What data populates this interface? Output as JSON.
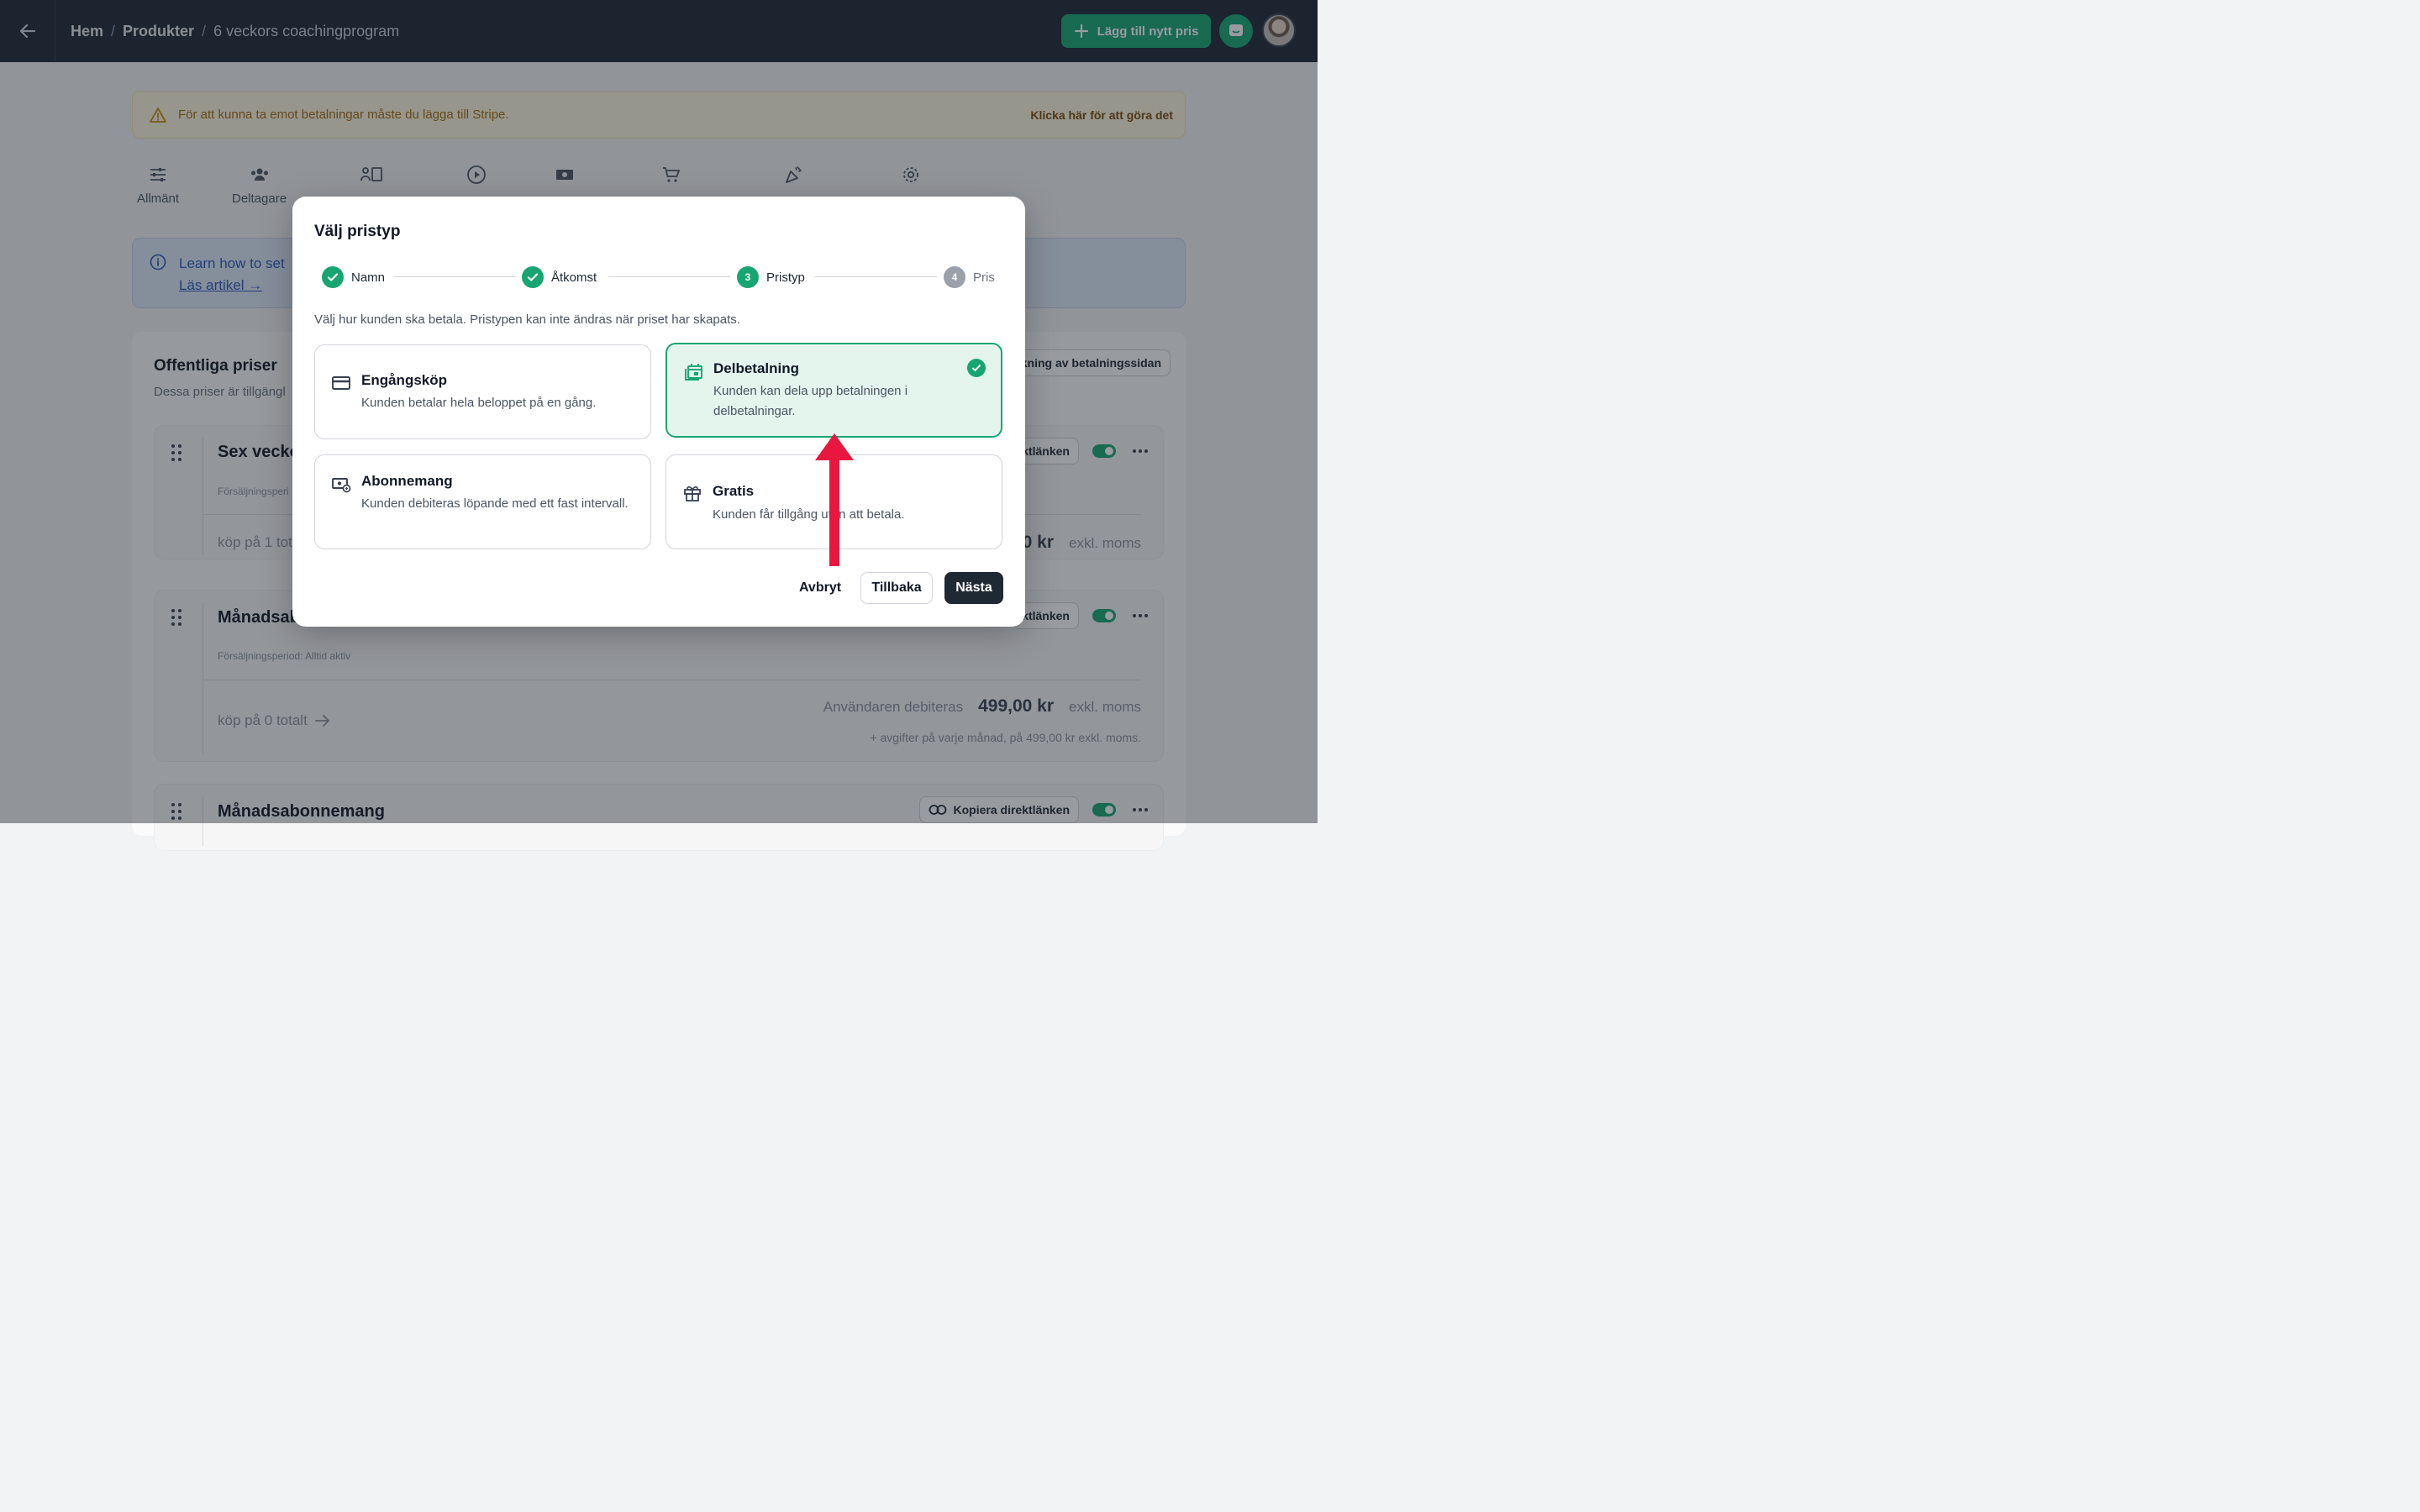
{
  "topbar": {
    "breadcrumb": [
      "Hem",
      "Produkter",
      "6 veckors coachingprogram"
    ],
    "add_price_label": "Lägg till nytt pris"
  },
  "warning": {
    "text": "För att kunna ta emot betalningar måste du lägga till Stripe.",
    "link": "Klicka här för att göra det"
  },
  "nav_tabs": [
    "Allmänt",
    "Deltagare"
  ],
  "info": {
    "text": "Learn how to set",
    "link": "Läs artikel →"
  },
  "prices_section": {
    "title": "Offentliga priser",
    "subtitle": "Dessa priser är tillgängl",
    "order_button": "kning av betalningssidan",
    "cards": [
      {
        "title": "Sex veckor",
        "period": "Försäljningsperi",
        "sold": "köp på 1 tot",
        "amount": "0 kr",
        "tax": "exkl. moms",
        "copy": "ktlänken"
      },
      {
        "title": "Månadsab",
        "period": "Försäljningsperiod: Alltid aktiv",
        "sold": "köp på 0 totalt",
        "debit_label": "Användaren debiteras",
        "amount": "499,00 kr",
        "tax": "exkl. moms",
        "fee": "+ avgifter på varje månad, på 499,00 kr exkl. moms.",
        "copy": "ktlänken"
      },
      {
        "title": "Månadsabonnemang",
        "copy": "Kopiera direktlänken"
      }
    ]
  },
  "modal": {
    "title": "Välj pristyp",
    "steps": [
      {
        "label": "Namn",
        "state": "done"
      },
      {
        "label": "Åtkomst",
        "state": "done"
      },
      {
        "label": "Pristyp",
        "number": "3",
        "state": "active"
      },
      {
        "label": "Pris",
        "number": "4",
        "state": "todo"
      }
    ],
    "description": "Välj hur kunden ska betala. Pristypen kan inte ändras när priset har skapats.",
    "options": [
      {
        "title": "Engångsköp",
        "desc": "Kunden betalar hela beloppet på en gång.",
        "icon": "credit-card-icon",
        "selected": false
      },
      {
        "title": "Delbetalning",
        "desc": "Kunden kan dela upp betalningen i delbetalningar.",
        "icon": "installment-icon",
        "selected": true
      },
      {
        "title": "Abonnemang",
        "desc": "Kunden debiteras löpande med ett fast intervall.",
        "icon": "subscription-icon",
        "selected": false
      },
      {
        "title": "Gratis",
        "desc": "Kunden får tillgång utan att betala.",
        "icon": "gift-icon",
        "selected": false
      }
    ],
    "buttons": {
      "cancel": "Avbryt",
      "back": "Tillbaka",
      "next": "Nästa"
    }
  },
  "colors": {
    "accent": "#17a672",
    "topbar": "#1d2733",
    "arrow": "#e8173f"
  }
}
